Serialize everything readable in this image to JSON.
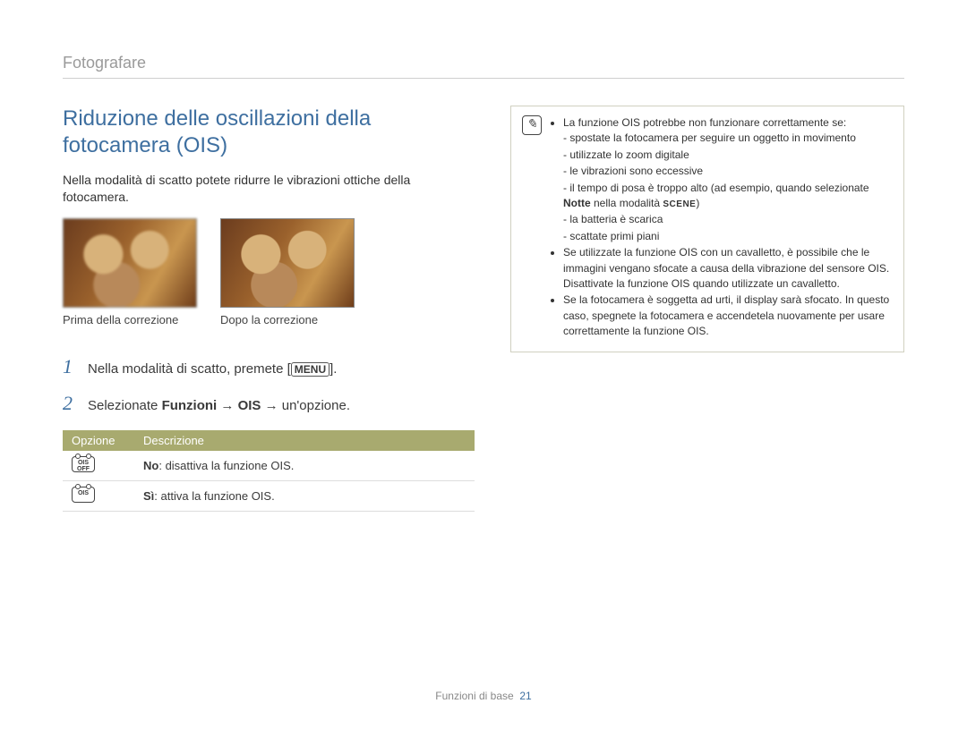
{
  "breadcrumb": "Fotografare",
  "title": "Riduzione delle oscillazioni della fotocamera (OIS)",
  "intro": "Nella modalità di scatto potete ridurre le vibrazioni ottiche della fotocamera.",
  "images": {
    "before_caption": "Prima della correzione",
    "after_caption": "Dopo la correzione"
  },
  "steps": [
    {
      "num": "1",
      "prefix": "Nella modalità di scatto, premete [",
      "badge": "MENU",
      "suffix": "]."
    },
    {
      "num": "2",
      "text_parts": {
        "a": "Selezionate ",
        "b": "Funzioni",
        "c": " → ",
        "d": "OIS",
        "e": " → un'opzione."
      }
    }
  ],
  "table": {
    "head_option": "Opzione",
    "head_desc": "Descrizione",
    "rows": [
      {
        "icon_label": "OIS OFF",
        "strong": "No",
        "rest": ": disattiva la funzione OIS."
      },
      {
        "icon_label": "OIS",
        "strong": "Sì",
        "rest": ": attiva la funzione OIS."
      }
    ]
  },
  "note": {
    "lead": "La funzione OIS potrebbe non funzionare correttamente se:",
    "sub": [
      "spostate la fotocamera per seguire un oggetto in movimento",
      "utilizzate lo zoom digitale",
      "le vibrazioni sono eccessive",
      "il tempo di posa è troppo alto (ad esempio, quando selezionate "
    ],
    "sub_notte_strong": "Notte",
    "sub_notte_mid": " nella modalità ",
    "sub_scene_badge": "SCENE",
    "sub_notte_end": ")",
    "sub2": [
      "la batteria è scarica",
      "scattate primi piani"
    ],
    "bullets_after": [
      "Se utilizzate la funzione OIS con un cavalletto, è possibile che le immagini vengano sfocate a causa della vibrazione del sensore OIS. Disattivate la funzione OIS quando utilizzate un cavalletto.",
      "Se la fotocamera è soggetta ad urti, il display sarà sfocato. In questo caso, spegnete la fotocamera e accendetela nuovamente per usare correttamente la funzione OIS."
    ]
  },
  "footer": {
    "section": "Funzioni di base",
    "page": "21"
  }
}
